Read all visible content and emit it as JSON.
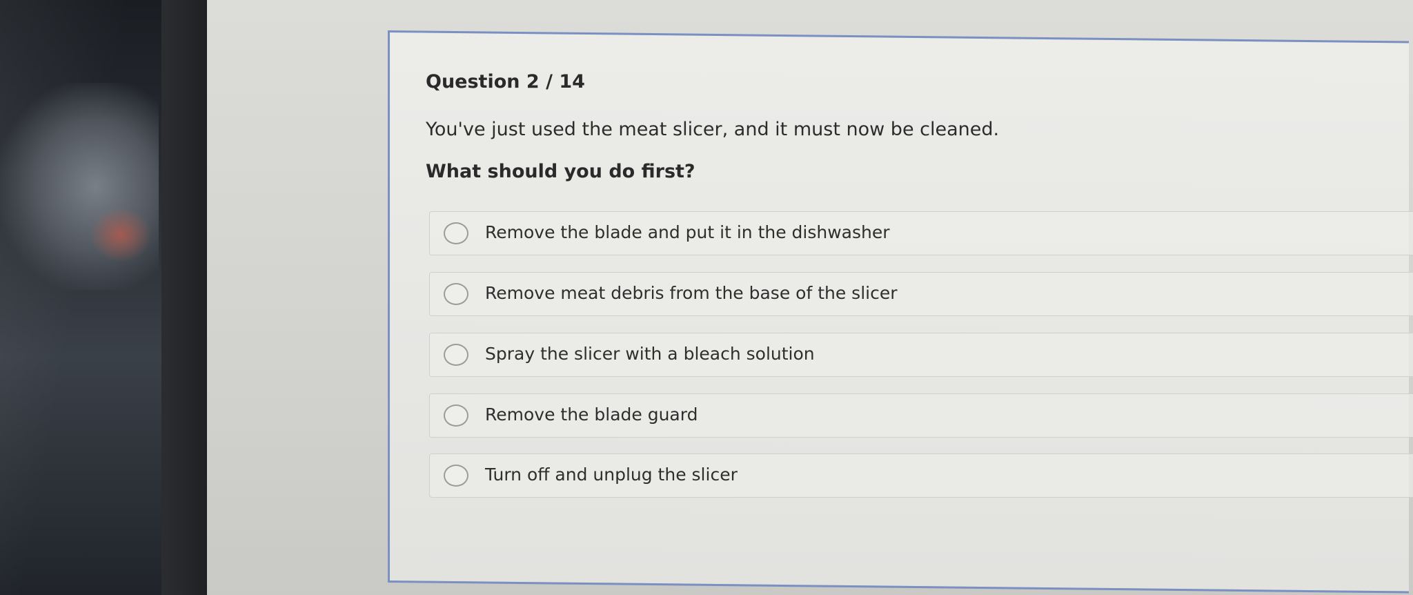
{
  "quiz": {
    "question_number": "Question 2 / 14",
    "prompt": "You've just used the meat slicer, and it must now be cleaned.",
    "ask": "What should you do first?",
    "options": [
      {
        "label": "Remove the blade and put it in the dishwasher"
      },
      {
        "label": "Remove meat debris from the base of the slicer"
      },
      {
        "label": "Spray the slicer with a bleach solution"
      },
      {
        "label": "Remove the blade guard"
      },
      {
        "label": "Turn off and unplug the slicer"
      }
    ]
  },
  "colors": {
    "card_border": "#7a90c2",
    "text": "#2a2a2a"
  }
}
